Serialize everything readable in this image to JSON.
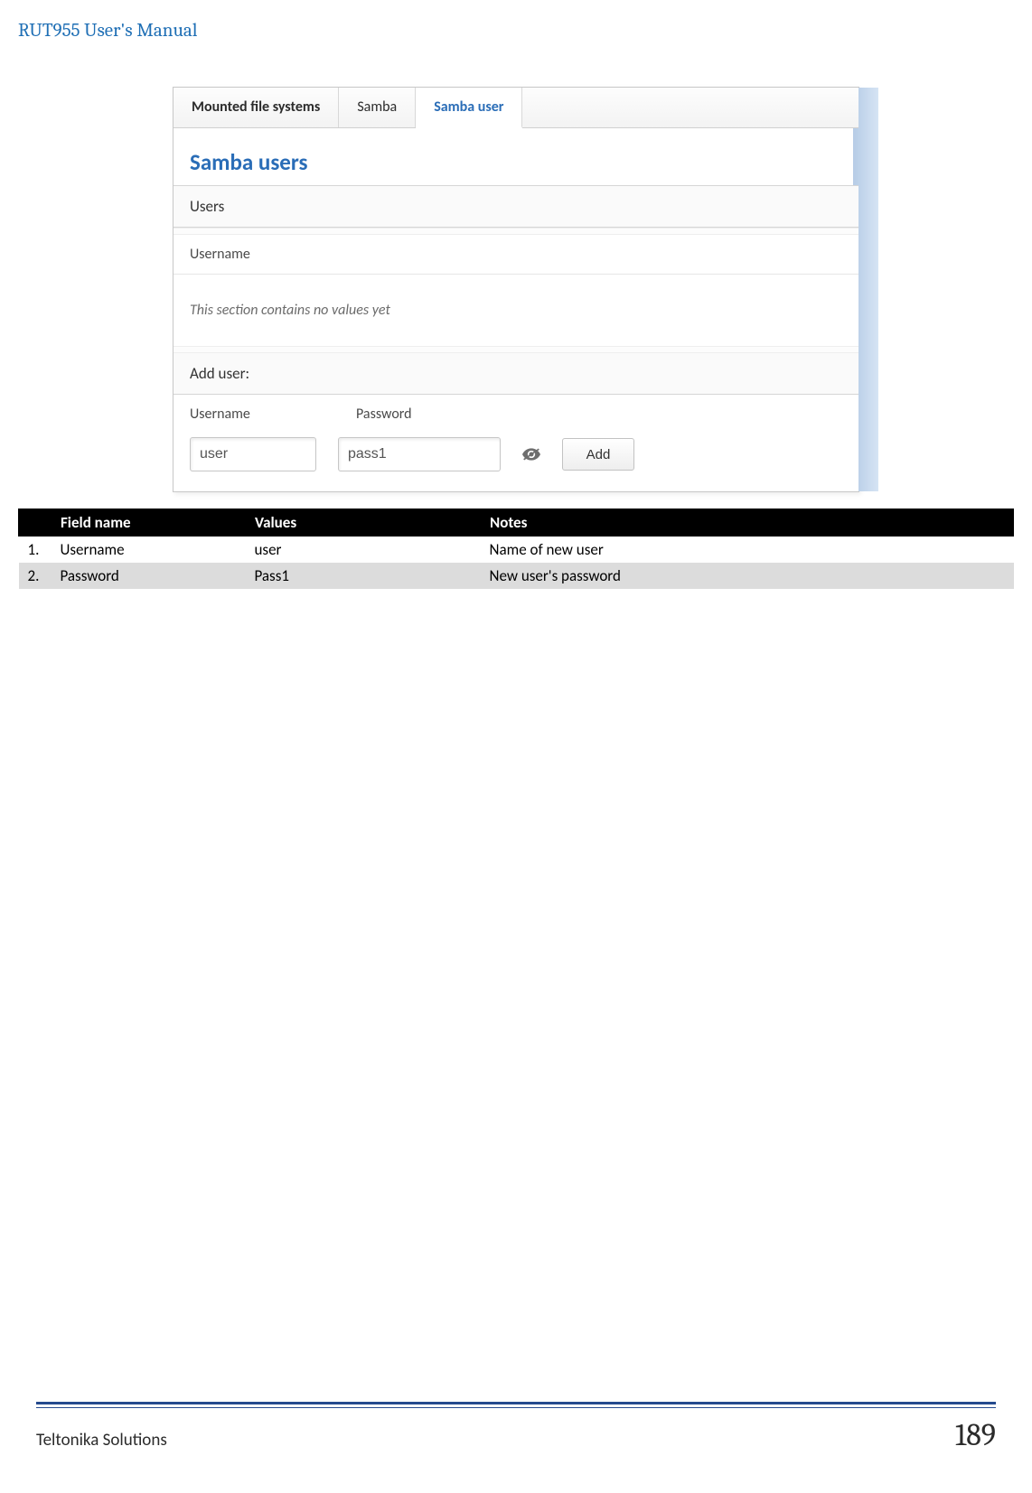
{
  "doc": {
    "title": "RUT955 User's Manual"
  },
  "screenshot": {
    "tabs": {
      "mounted": "Mounted file systems",
      "samba": "Samba",
      "samba_user": "Samba user"
    },
    "page_title": "Samba users",
    "users_header": "Users",
    "username_subhead": "Username",
    "no_values": "This section contains no values yet",
    "add_user_header": "Add user:",
    "col_user": "Username",
    "col_pass": "Password",
    "input_user": "user",
    "input_pass": "pass1",
    "btn_add": "Add"
  },
  "table": {
    "headers": {
      "idx": "",
      "field_name": "Field name",
      "values": "Values",
      "notes": "Notes"
    },
    "rows": [
      {
        "idx": "1.",
        "field": "Username",
        "value": "user",
        "note": "Name of new user"
      },
      {
        "idx": "2.",
        "field": "Password",
        "value": "Pass1",
        "note": "New user's password"
      }
    ]
  },
  "footer": {
    "left": "Teltonika Solutions",
    "right": "189"
  }
}
